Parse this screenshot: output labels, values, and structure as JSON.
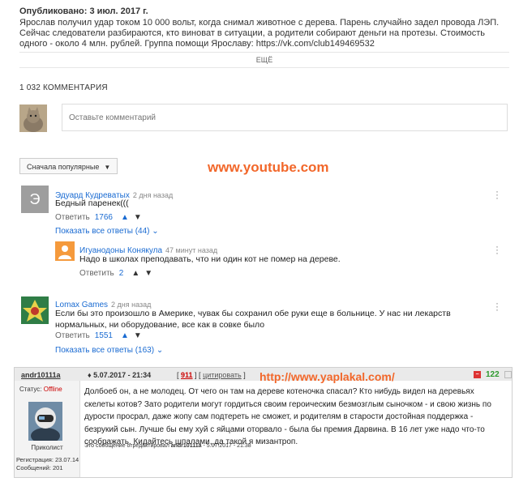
{
  "video": {
    "published": "Опубликовано: 3 июл. 2017 г.",
    "description": "Ярослав получил удар током 10 000 вольт, когда снимал животное с дерева. Парень случайно задел провода ЛЭП. Сейчас следователи разбираются, кто виноват в ситуации, а родители собирают деньги на протезы. Стоимость одного - около 4 млн. рублей. Группа помощи Ярославу: https://vk.com/club149469532",
    "more_label": "ЕЩЁ"
  },
  "comments": {
    "count_label": "1 032 КОММЕНТАРИЯ",
    "input_placeholder": "Оставьте комментарий",
    "sort_label": "Сначала популярные",
    "items": [
      {
        "avatar_letter": "Э",
        "author": "Эдуард Кудреватых",
        "time": "2 дня назад",
        "text": "Бедный паренек(((",
        "reply_label": "Ответить",
        "likes": "1766",
        "show_replies": "Показать все ответы (44)",
        "reply": {
          "author": "Игуанодоны Конякула",
          "time": "47 минут назад",
          "text": "Надо в школах преподавать, что ни один кот не помер на дереве.",
          "reply_label": "Ответить",
          "likes": "2"
        }
      },
      {
        "author": "Lomax Games",
        "time": "2 дня назад",
        "text": "Если бы это произошло в Америке, чувак бы сохранил обе руки еще в больнице. У нас ни лекарств нормальных, ни оборудование, все как в совке было",
        "reply_label": "Ответить",
        "likes": "1551",
        "show_replies": "Показать все ответы (163)"
      }
    ]
  },
  "watermarks": {
    "youtube": "www.youtube.com",
    "yaplakal": "http://www.yaplakal.com/"
  },
  "forum_post": {
    "username": "andr10111a",
    "date": "5.07.2017 - 21:34",
    "post_number": "911",
    "quote_label": "цитировать",
    "rating": "122",
    "status_label": "Статус:",
    "status_value": "Offline",
    "rank": "Приколист",
    "registration": "Регистрация: 23.07.14",
    "messages": "Сообщений: 201",
    "text": "Долбоеб он, а не молодец. От чего он там на дереве котеночка спасал? Кто нибудь видел на деревьях скелеты котов? Зато родители могут гордиться своим героическим безмозглым сыночком - и свою жизнь по дурости просрал, даже жопу сам подтереть не сможет, и родителям в старости достойная поддержка - безрукий сын. Лучше бы ему хуй с яйцами оторвало - была бы премия Дарвина. В 16 лет уже надо что-то соображать. Кидайтесь шпалами, да такой я мизантроп.",
    "edited_prefix": "Это сообщение отредактировал",
    "edited_user": "andr10111a",
    "edited_date": "- 5.07.2017 - 21:38"
  },
  "colors": {
    "accent_blue": "#1a6bd2",
    "watermark_orange": "#f2672a",
    "offline_red": "#cc0000",
    "rating_green": "#2c9a2c"
  }
}
